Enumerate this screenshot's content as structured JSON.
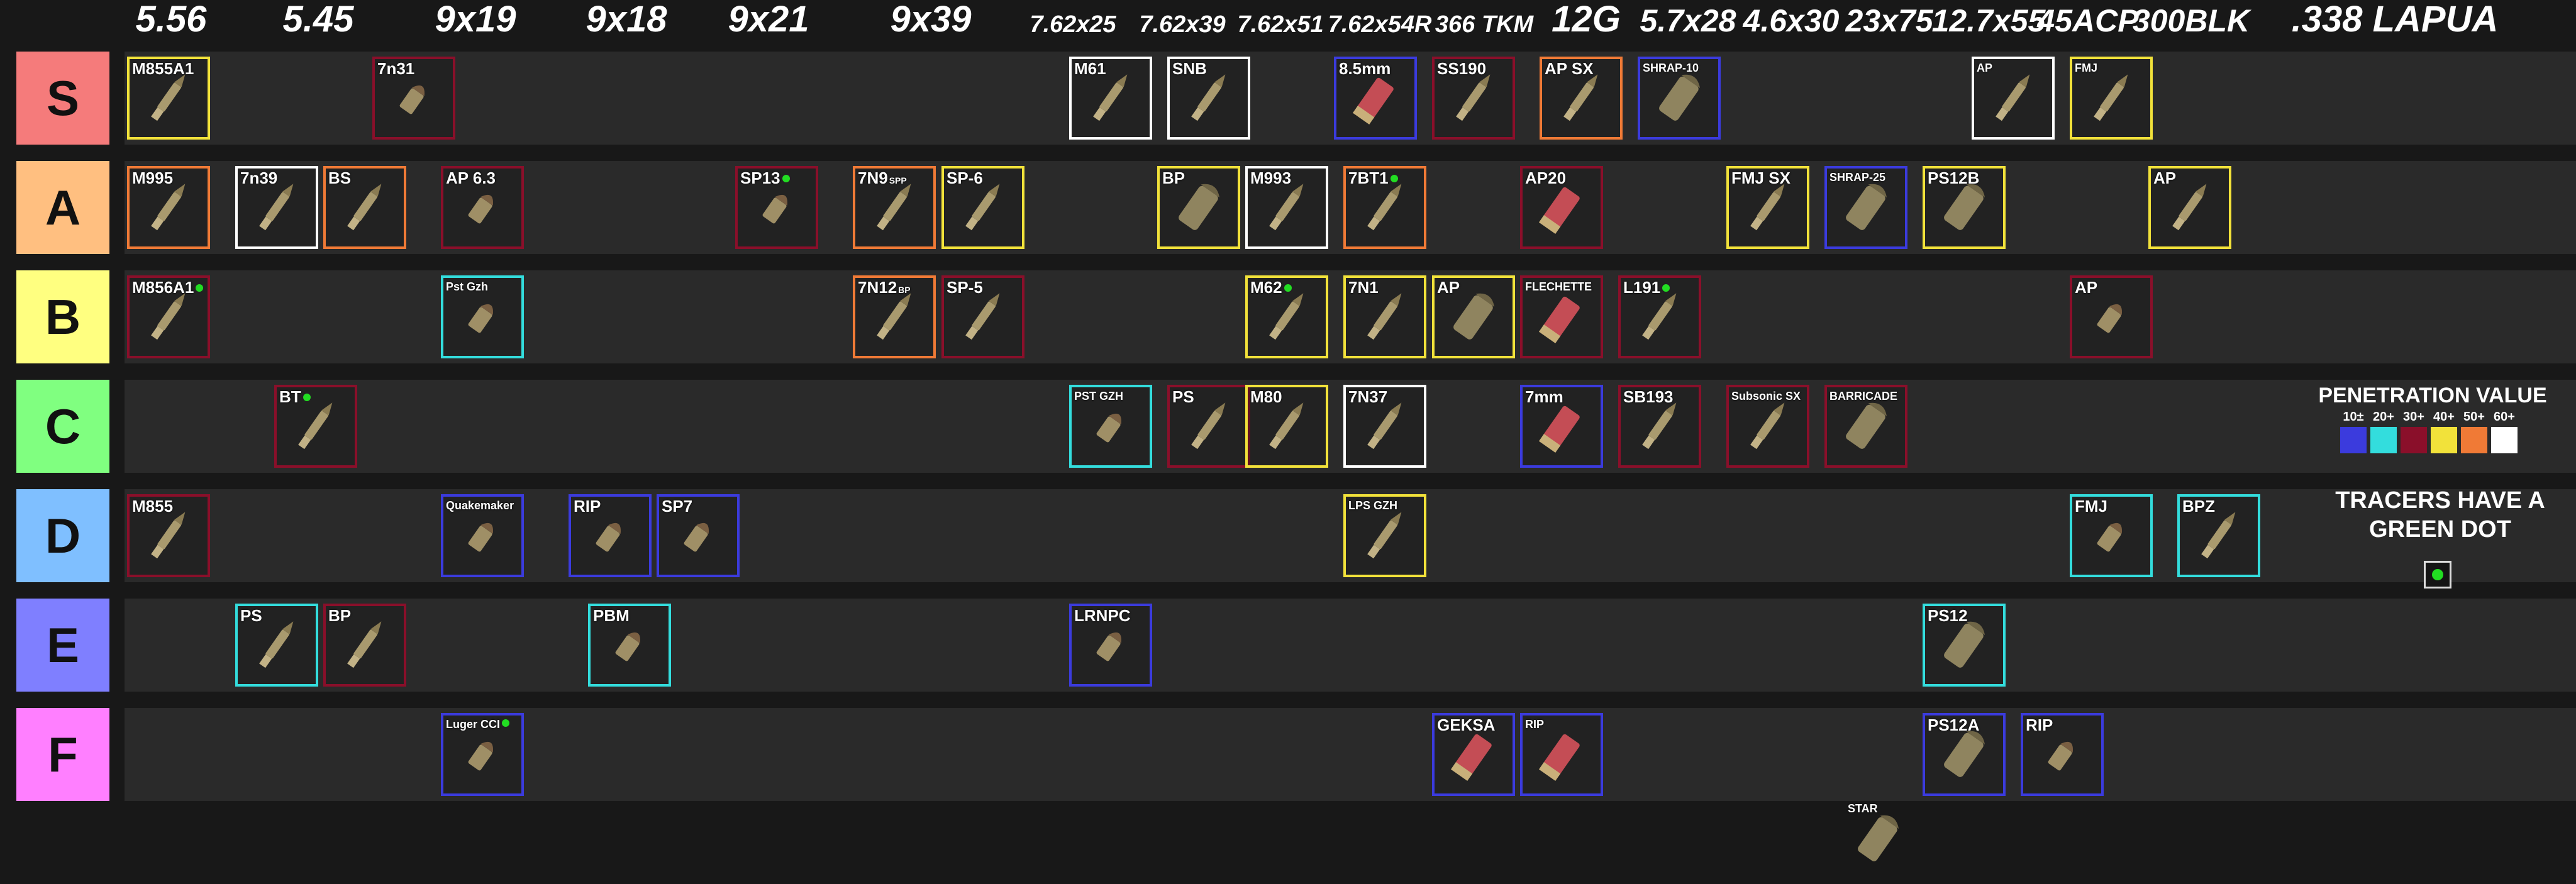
{
  "calibers": [
    {
      "label": "5.56",
      "size": "big"
    },
    {
      "label": "5.45",
      "size": "big"
    },
    {
      "label": "9x19",
      "size": "big"
    },
    {
      "label": "9x18",
      "size": "big"
    },
    {
      "label": "9x21",
      "size": "big"
    },
    {
      "label": "9x39",
      "size": "big"
    },
    {
      "label": "7.62x25",
      "size": "small"
    },
    {
      "label": "7.62x39",
      "size": "small"
    },
    {
      "label": "7.62x51",
      "size": "small"
    },
    {
      "label": "7.62x54R",
      "size": "small"
    },
    {
      "label": "366 TKM",
      "size": "small"
    },
    {
      "label": "12G",
      "size": "big"
    },
    {
      "label": "5.7x28",
      "size": "mid"
    },
    {
      "label": "4.6x30",
      "size": "mid"
    },
    {
      "label": "23x75",
      "size": "mid"
    },
    {
      "label": "12.7x55",
      "size": "mid"
    },
    {
      "label": "45ACP",
      "size": "mid"
    },
    {
      "label": "300BLK",
      "size": "mid"
    },
    {
      "label": ".338 LAPUA",
      "size": "big"
    }
  ],
  "colors": {
    "pen10": "#3b3bdd",
    "pen20": "#33dddd",
    "pen30": "#8a0f2a",
    "pen40": "#f2e23a",
    "pen50": "#f07a36",
    "pen60": "#ffffff",
    "tracer": "#22dd22"
  },
  "tiers": [
    {
      "label": "S",
      "color": "#f57b7b",
      "items": [
        {
          "name": "M855A1",
          "col": "0",
          "pen": "pen40",
          "shape": "rifle"
        },
        {
          "name": "7n31",
          "col": "2.5",
          "pen": "pen30",
          "shape": "pistol"
        },
        {
          "name": "M61",
          "col": "9.6",
          "pen": "pen60",
          "shape": "rifle"
        },
        {
          "name": "SNB",
          "col": "10.6",
          "pen": "pen60",
          "shape": "rifle"
        },
        {
          "name": "8.5mm",
          "col": "12.3",
          "pen": "pen10",
          "shape": "shell"
        },
        {
          "name": "SS190",
          "col": "13.3",
          "pen": "pen30",
          "shape": "rifle"
        },
        {
          "name": "AP SX",
          "col": "14.4",
          "pen": "pen50",
          "shape": "rifle"
        },
        {
          "name": "SHRAP-10",
          "col": "15.4",
          "pen": "pen10",
          "shape": "big",
          "small": true
        },
        {
          "name": "AP",
          "col": "18.8",
          "pen": "pen60",
          "shape": "rifle",
          "small": true
        },
        {
          "name": "FMJ",
          "col": "19.8",
          "pen": "pen40",
          "shape": "rifle",
          "small": true
        }
      ]
    },
    {
      "label": "A",
      "color": "#ffbf80",
      "items": [
        {
          "name": "M995",
          "col": "0",
          "pen": "pen50",
          "shape": "rifle"
        },
        {
          "name": "7n39",
          "col": "1.1",
          "pen": "pen60",
          "shape": "rifle"
        },
        {
          "name": "BS",
          "col": "2",
          "pen": "pen50",
          "shape": "rifle"
        },
        {
          "name": "AP 6.3",
          "col": "3.2",
          "pen": "pen30",
          "shape": "pistol"
        },
        {
          "name": "SP13",
          "col": "6.2",
          "pen": "pen30",
          "shape": "pistol",
          "tracer": true
        },
        {
          "name": "7N9",
          "sup": "SPP",
          "col": "7.4",
          "pen": "pen50",
          "shape": "rifle"
        },
        {
          "name": "SP-6",
          "col": "8.3",
          "pen": "pen40",
          "shape": "rifle"
        },
        {
          "name": "BP",
          "col": "10.5",
          "pen": "pen40",
          "shape": "big"
        },
        {
          "name": "M993",
          "col": "11.4",
          "pen": "pen60",
          "shape": "rifle"
        },
        {
          "name": "7BT1",
          "col": "12.4",
          "pen": "pen50",
          "shape": "rifle",
          "tracer": true
        },
        {
          "name": "AP20",
          "col": "14.2",
          "pen": "pen30",
          "shape": "shell"
        },
        {
          "name": "FMJ SX",
          "col": "16.3",
          "pen": "pen40",
          "shape": "rifle"
        },
        {
          "name": "SHRAP-25",
          "col": "17.3",
          "pen": "pen10",
          "shape": "big",
          "small": true
        },
        {
          "name": "PS12B",
          "col": "18.3",
          "pen": "pen40",
          "shape": "big"
        },
        {
          "name": "AP",
          "col": "20.6",
          "pen": "pen40",
          "shape": "rifle"
        }
      ]
    },
    {
      "label": "B",
      "color": "#ffff80",
      "items": [
        {
          "name": "M856A1",
          "col": "0",
          "pen": "pen30",
          "shape": "rifle",
          "tracer": true
        },
        {
          "name": "Pst Gzh",
          "col": "3.2",
          "pen": "pen20",
          "shape": "pistol",
          "small": true
        },
        {
          "name": "7N12",
          "sup": "BP",
          "col": "7.4",
          "pen": "pen50",
          "shape": "rifle"
        },
        {
          "name": "SP-5",
          "col": "8.3",
          "pen": "pen30",
          "shape": "rifle"
        },
        {
          "name": "M62",
          "col": "11.4",
          "pen": "pen40",
          "shape": "rifle",
          "tracer": true
        },
        {
          "name": "7N1",
          "col": "12.4",
          "pen": "pen40",
          "shape": "rifle"
        },
        {
          "name": "AP",
          "col": "13.3",
          "pen": "pen40",
          "shape": "big"
        },
        {
          "name": "FLECHETTE",
          "col": "14.2",
          "pen": "pen30",
          "shape": "shell",
          "small": true
        },
        {
          "name": "L191",
          "col": "15.2",
          "pen": "pen30",
          "shape": "rifle",
          "tracer": true
        },
        {
          "name": "AP",
          "col": "19.8",
          "pen": "pen30",
          "shape": "pistol"
        }
      ]
    },
    {
      "label": "C",
      "color": "#80ff80",
      "items": [
        {
          "name": "BT",
          "col": "1.5",
          "pen": "pen30",
          "shape": "rifle",
          "tracer": true
        },
        {
          "name": "PST GZH",
          "col": "9.6",
          "pen": "pen20",
          "shape": "pistol",
          "small": true
        },
        {
          "name": "PS",
          "col": "10.6",
          "pen": "pen30",
          "shape": "rifle"
        },
        {
          "name": "M80",
          "col": "11.4",
          "pen": "pen40",
          "shape": "rifle"
        },
        {
          "name": "7N37",
          "col": "12.4",
          "pen": "pen60",
          "shape": "rifle"
        },
        {
          "name": "7mm",
          "col": "14.2",
          "pen": "pen10",
          "shape": "shell"
        },
        {
          "name": "SB193",
          "col": "15.2",
          "pen": "pen30",
          "shape": "rifle"
        },
        {
          "name": "Subsonic SX",
          "col": "16.3",
          "pen": "pen30",
          "shape": "rifle",
          "small": true
        },
        {
          "name": "BARRICADE",
          "col": "17.3",
          "pen": "pen30",
          "shape": "big",
          "small": true
        }
      ]
    },
    {
      "label": "D",
      "color": "#7fbfff",
      "items": [
        {
          "name": "M855",
          "col": "0",
          "pen": "pen30",
          "shape": "rifle"
        },
        {
          "name": "Quakemaker",
          "col": "3.2",
          "pen": "pen10",
          "shape": "pistol",
          "small": true
        },
        {
          "name": "RIP",
          "col": "4.5",
          "pen": "pen10",
          "shape": "pistol"
        },
        {
          "name": "SP7",
          "col": "5.4",
          "pen": "pen10",
          "shape": "pistol"
        },
        {
          "name": "LPS GZH",
          "col": "12.4",
          "pen": "pen40",
          "shape": "rifle",
          "small": true
        },
        {
          "name": "FMJ",
          "col": "19.8",
          "pen": "pen20",
          "shape": "pistol"
        },
        {
          "name": "BPZ",
          "col": "20.9",
          "pen": "pen20",
          "shape": "rifle"
        }
      ]
    },
    {
      "label": "E",
      "color": "#7f7fff",
      "items": [
        {
          "name": "PS",
          "col": "1.1",
          "pen": "pen20",
          "shape": "rifle"
        },
        {
          "name": "BP",
          "col": "2",
          "pen": "pen30",
          "shape": "rifle"
        },
        {
          "name": "PBM",
          "col": "4.7",
          "pen": "pen20",
          "shape": "pistol"
        },
        {
          "name": "LRNPC",
          "col": "9.6",
          "pen": "pen10",
          "shape": "pistol"
        },
        {
          "name": "PS12",
          "col": "18.3",
          "pen": "pen20",
          "shape": "big"
        }
      ]
    },
    {
      "label": "F",
      "color": "#ff7fff",
      "items": [
        {
          "name": "Luger CCI",
          "col": "3.2",
          "pen": "pen10",
          "shape": "pistol",
          "small": true,
          "tracer": true
        },
        {
          "name": "GEKSA",
          "col": "13.3",
          "pen": "pen10",
          "shape": "shell"
        },
        {
          "name": "RIP",
          "col": "14.2",
          "pen": "pen10",
          "shape": "shell",
          "small": true
        },
        {
          "name": "PS12A",
          "col": "18.3",
          "pen": "pen10",
          "shape": "big"
        },
        {
          "name": "RIP",
          "col": "19.3",
          "pen": "pen10",
          "shape": "pistol"
        }
      ]
    }
  ],
  "extra_item": {
    "name": "STAR",
    "shape": "big"
  },
  "legend": {
    "title": "PENETRATION VALUE",
    "levels": [
      {
        "label": "10±",
        "color": "pen10"
      },
      {
        "label": "20+",
        "color": "pen20"
      },
      {
        "label": "30+",
        "color": "pen30"
      },
      {
        "label": "40+",
        "color": "pen40"
      },
      {
        "label": "50+",
        "color": "pen50"
      },
      {
        "label": "60+",
        "color": "pen60"
      }
    ],
    "tracer_note": "TRACERS HAVE A GREEN DOT"
  }
}
